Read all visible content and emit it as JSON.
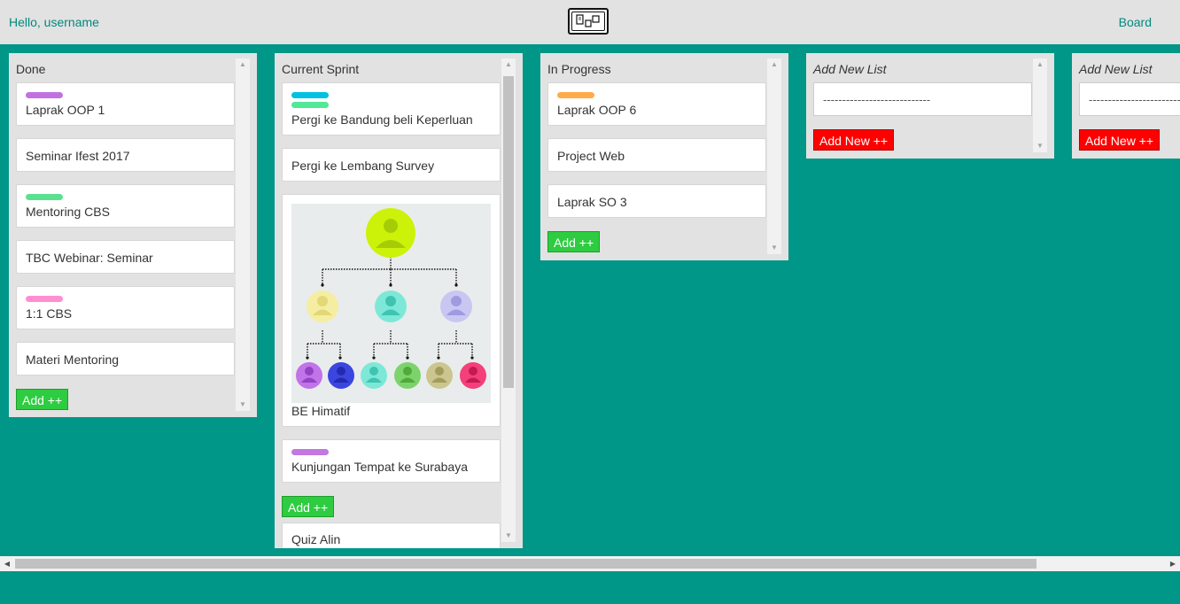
{
  "header": {
    "greeting": "Hello, username",
    "board_link": "Board",
    "logo_icon": "sticky-notes-board-icon"
  },
  "colors": {
    "background": "#009688",
    "header_bg": "#e2e2e2",
    "list_bg": "#e2e2e2",
    "link": "#00897b",
    "add_button": "#2ecc40",
    "add_new_button": "#ff0000"
  },
  "lists": [
    {
      "title": "Done",
      "add_label": "Add ++",
      "cards": [
        {
          "title": "Laprak OOP 1",
          "labels": [
            "#c073e0"
          ]
        },
        {
          "title": "Seminar Ifest 2017",
          "labels": []
        },
        {
          "title": "Mentoring CBS",
          "labels": [
            "#5ae18f"
          ]
        },
        {
          "title": "TBC Webinar: Seminar",
          "labels": []
        },
        {
          "title": "1:1 CBS",
          "labels": [
            "#ff8fd2"
          ]
        },
        {
          "title": "Materi Mentoring",
          "labels": []
        }
      ]
    },
    {
      "title": "Current Sprint",
      "add_label": "Add ++",
      "cards": [
        {
          "title": "Pergi ke Bandung beli Keperluan",
          "labels": [
            "#00c2e0",
            "#51e898"
          ]
        },
        {
          "title": "Pergi ke Lembang Survey",
          "labels": []
        },
        {
          "title": "BE Himatif",
          "labels": [],
          "image": "org-chart-image"
        },
        {
          "title": "Kunjungan Tempat ke Surabaya",
          "labels": [
            "#c377e0"
          ]
        },
        {
          "title": "Quiz Alin",
          "labels": []
        }
      ]
    },
    {
      "title": "In Progress",
      "add_label": "Add ++",
      "cards": [
        {
          "title": "Laprak OOP 6",
          "labels": [
            "#ffab4a"
          ]
        },
        {
          "title": "Project Web",
          "labels": []
        },
        {
          "title": "Laprak SO 3",
          "labels": []
        }
      ]
    }
  ],
  "new_lists": [
    {
      "title": "Add New List",
      "input_value": "----------------------------",
      "button_label": "Add New ++"
    },
    {
      "title": "Add New List",
      "input_value": "----------------------------",
      "button_label": "Add New ++"
    }
  ]
}
